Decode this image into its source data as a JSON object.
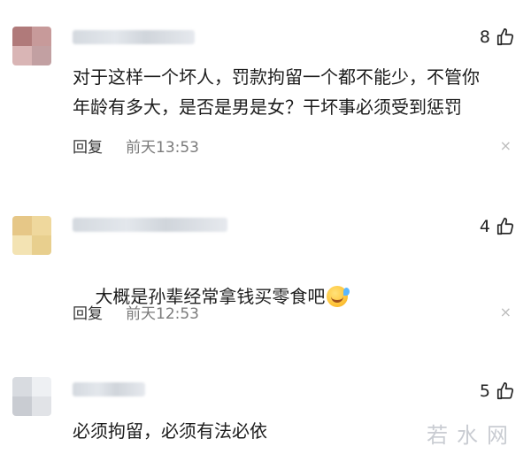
{
  "comments": [
    {
      "likes": "8",
      "text": "对于这样一个坏人，罚款拘留一个都不能少，不管你\n年龄有多大，是否是男是女？干坏事必须受到惩罚",
      "reply_label": "回复",
      "time": "前天13:53",
      "close": "×"
    },
    {
      "likes": "4",
      "text": "大概是孙辈经常拿钱买零食吧",
      "emoji": "laughing-crying-emoji",
      "reply_label": "回复",
      "time": "前天12:53",
      "close": "×"
    },
    {
      "likes": "5",
      "text": "必须拘留，必须有法必依"
    }
  ],
  "watermark": "若水网",
  "colors": {
    "text": "#1c1c1c",
    "time": "#7b7b7b",
    "close": "#bcbcbc",
    "watermark": "#c9ccd2"
  },
  "icons": [
    "thumbs-up-icon",
    "close-icon"
  ]
}
